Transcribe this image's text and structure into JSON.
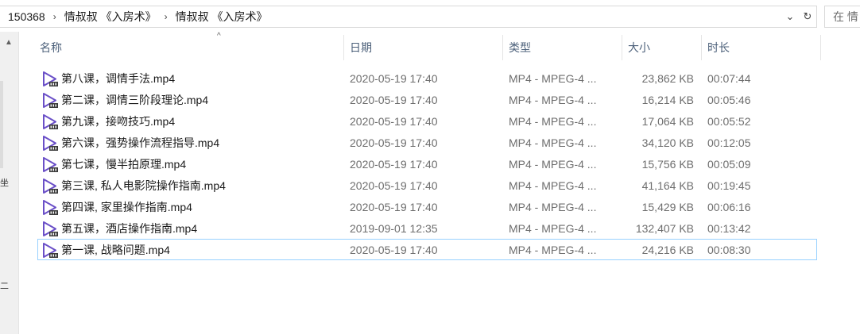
{
  "address": {
    "crumbs": [
      "150368",
      "情叔叔 《入房术》",
      "情叔叔 《入房术》"
    ],
    "separator": "›",
    "dropdown_glyph": "⌄",
    "refresh_glyph": "↻"
  },
  "search": {
    "placeholder": "在 情"
  },
  "nav": {
    "up_glyph": "▲",
    "frag1": "坐",
    "frag2": "二"
  },
  "columns": {
    "name": "名称",
    "date": "日期",
    "type": "类型",
    "size": "大小",
    "duration": "时长",
    "sort_indicator": "^"
  },
  "colors": {
    "video_icon": "#6b50c8",
    "focus_border": "#99d1ff"
  },
  "files": [
    {
      "icon": "video-file-icon",
      "name": "第八课，调情手法.mp4",
      "date": "2020-05-19 17:40",
      "type": "MP4 - MPEG-4 ...",
      "size": "23,862 KB",
      "duration": "00:07:44"
    },
    {
      "icon": "video-file-icon",
      "name": "第二课，调情三阶段理论.mp4",
      "date": "2020-05-19 17:40",
      "type": "MP4 - MPEG-4 ...",
      "size": "16,214 KB",
      "duration": "00:05:46"
    },
    {
      "icon": "video-file-icon",
      "name": "第九课，接吻技巧.mp4",
      "date": "2020-05-19 17:40",
      "type": "MP4 - MPEG-4 ...",
      "size": "17,064 KB",
      "duration": "00:05:52"
    },
    {
      "icon": "video-file-icon",
      "name": "第六课，强势操作流程指导.mp4",
      "date": "2020-05-19 17:40",
      "type": "MP4 - MPEG-4 ...",
      "size": "34,120 KB",
      "duration": "00:12:05"
    },
    {
      "icon": "video-file-icon",
      "name": "第七课，慢半拍原理.mp4",
      "date": "2020-05-19 17:40",
      "type": "MP4 - MPEG-4 ...",
      "size": "15,756 KB",
      "duration": "00:05:09"
    },
    {
      "icon": "video-file-icon",
      "name": "第三课, 私人电影院操作指南.mp4",
      "date": "2020-05-19 17:40",
      "type": "MP4 - MPEG-4 ...",
      "size": "41,164 KB",
      "duration": "00:19:45"
    },
    {
      "icon": "video-file-icon",
      "name": "第四课, 家里操作指南.mp4",
      "date": "2020-05-19 17:40",
      "type": "MP4 - MPEG-4 ...",
      "size": "15,429 KB",
      "duration": "00:06:16"
    },
    {
      "icon": "video-file-icon",
      "name": "第五课，酒店操作指南.mp4",
      "date": "2019-09-01 12:35",
      "type": "MP4 - MPEG-4 ...",
      "size": "132,407 KB",
      "duration": "00:13:42"
    },
    {
      "icon": "video-file-icon",
      "name": "第一课, 战略问题.mp4",
      "date": "2020-05-19 17:40",
      "type": "MP4 - MPEG-4 ...",
      "size": "24,216 KB",
      "duration": "00:08:30"
    }
  ]
}
